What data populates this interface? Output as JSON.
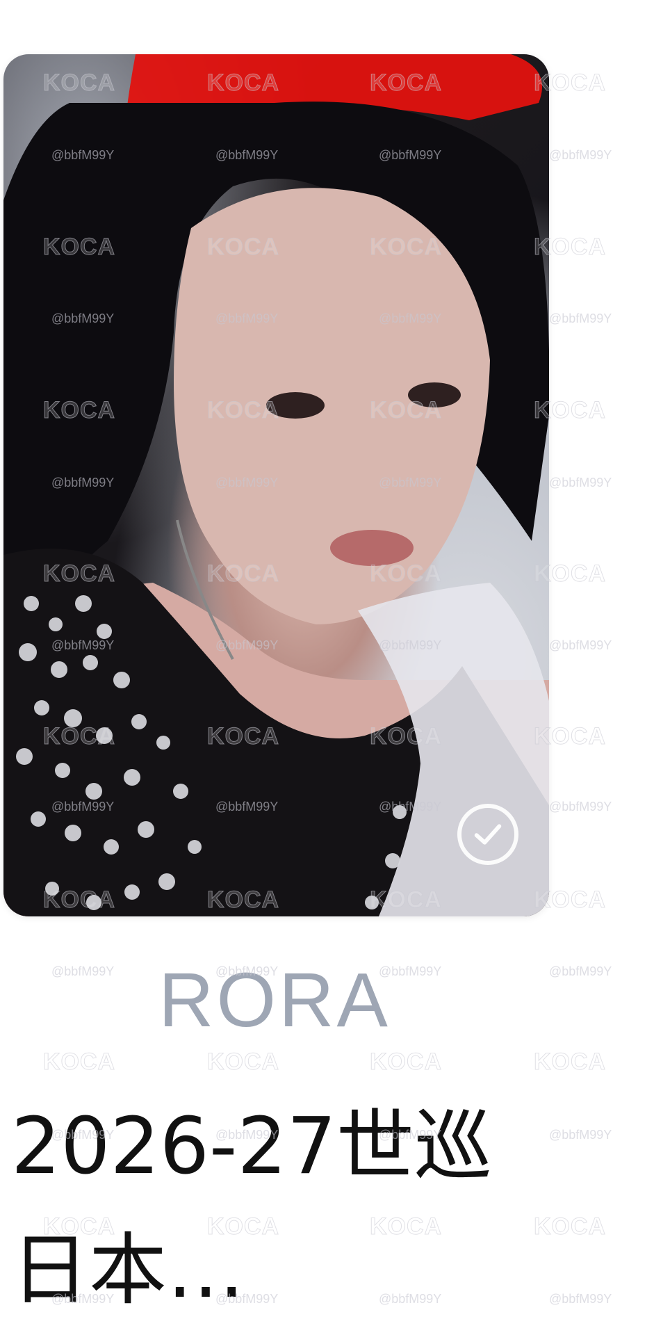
{
  "card": {
    "checked": true
  },
  "member_name": "RORA",
  "item_title": "2026-27世巡 日本…",
  "watermarks": {
    "logo": "KOCA",
    "handle": "@bbfM99Y"
  },
  "icons": {
    "check": "check-circle-icon"
  },
  "colors": {
    "member_name": "#9ea6b4",
    "title": "#111111",
    "background": "#ffffff"
  }
}
